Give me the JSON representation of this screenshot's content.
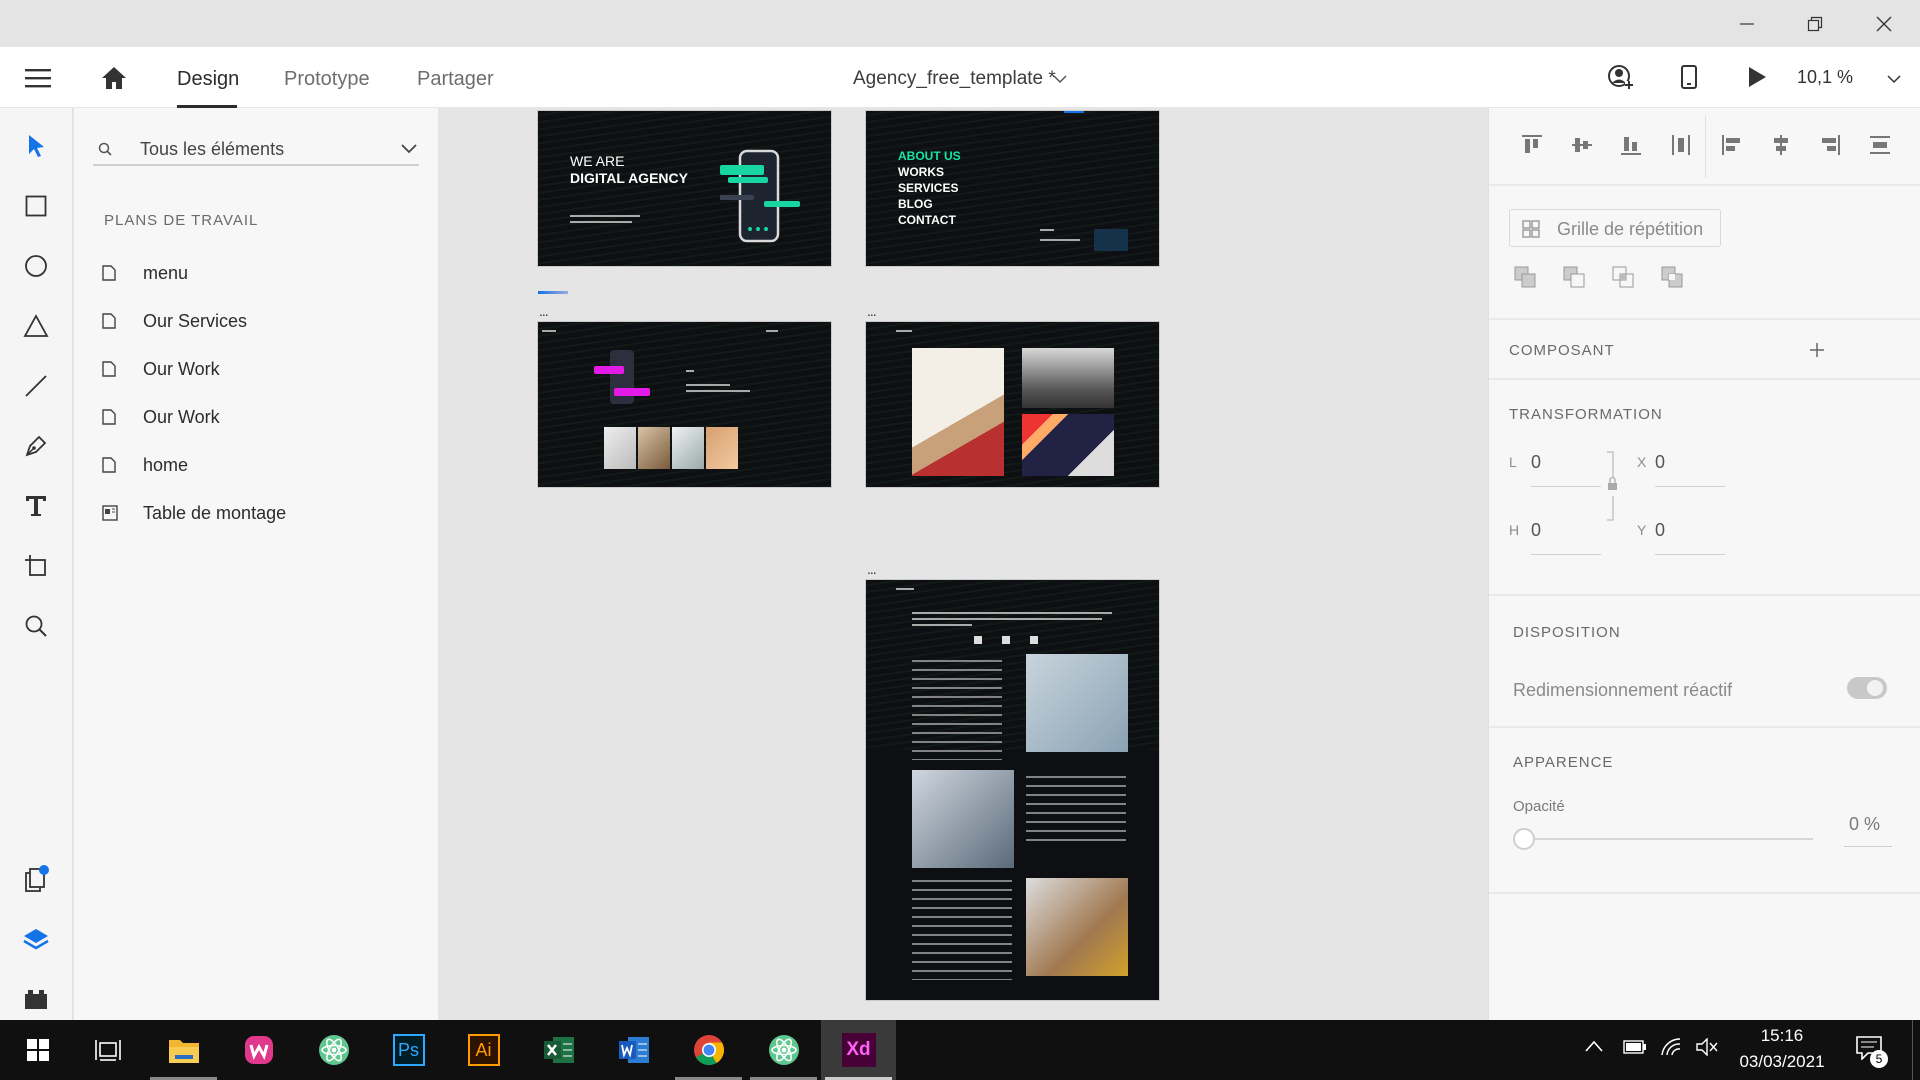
{
  "header": {
    "tabs": [
      "Design",
      "Prototype",
      "Partager"
    ],
    "active_tab": "Design",
    "document_title": "Agency_free_template *",
    "zoom": "10,1 %"
  },
  "layers": {
    "search_placeholder": "Tous les éléments",
    "section_title": "PLANS DE TRAVAIL",
    "items": [
      {
        "label": "menu",
        "icon": "artboard-icon"
      },
      {
        "label": "Our Services",
        "icon": "artboard-icon"
      },
      {
        "label": "Our Work",
        "icon": "artboard-icon"
      },
      {
        "label": "Our Work",
        "icon": "artboard-icon"
      },
      {
        "label": "home",
        "icon": "artboard-icon"
      },
      {
        "label": "Table de montage",
        "icon": "pasteboard-icon"
      }
    ]
  },
  "canvas": {
    "hero": {
      "line1": "WE ARE",
      "line2": "DIGITAL AGENCY"
    },
    "menu": [
      "ABOUT US",
      "WORKS",
      "SERVICES",
      "BLOG",
      "CONTACT"
    ],
    "dots": "..."
  },
  "props": {
    "repeat_grid": "Grille de répétition",
    "component": "COMPOSANT",
    "transformation": "TRANSFORMATION",
    "w_label": "L",
    "w_value": "0",
    "h_label": "H",
    "h_value": "0",
    "x_label": "X",
    "x_value": "0",
    "y_label": "Y",
    "y_value": "0",
    "layout": "DISPOSITION",
    "responsive": "Redimensionnement réactif",
    "appearance": "APPARENCE",
    "opacity_label": "Opacité",
    "opacity_value": "0 %",
    "opacity": 0
  },
  "taskbar": {
    "time": "15:16",
    "date": "03/03/2021",
    "notification_count": "5",
    "apps": [
      "start-icon",
      "task-view-icon",
      "file-explorer-icon",
      "wampserver-icon",
      "atom-icon",
      "photoshop-icon",
      "illustrator-icon",
      "excel-icon",
      "word-icon",
      "chrome-icon",
      "atom-icon",
      "xd-icon"
    ],
    "app_labels": {
      "ps": "Ps",
      "ai": "Ai",
      "xd": "Xd"
    }
  },
  "colors": {
    "accent": "#1473e6",
    "menu_green": "#16e3a4",
    "magenta": "#e21ce6"
  }
}
